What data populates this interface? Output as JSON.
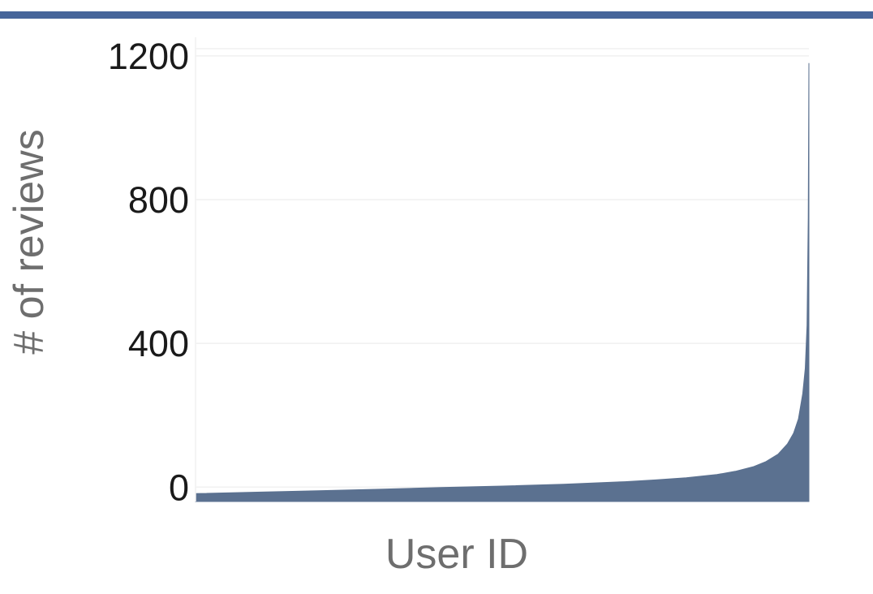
{
  "chart_data": {
    "type": "area",
    "title": "",
    "xlabel": "User ID",
    "ylabel": "# of reviews",
    "xlim": [
      0,
      1
    ],
    "ylim": [
      -40,
      1220
    ],
    "yticks": [
      0,
      400,
      800,
      1200
    ],
    "x_tick_labels_shown": false,
    "grid": true,
    "legend": "none",
    "fill_color": "#5b7190",
    "rule_color": "#46659a",
    "series": [
      {
        "x": [
          0,
          0.1,
          0.2,
          0.3,
          0.4,
          0.5,
          0.6,
          0.7,
          0.75,
          0.8,
          0.85,
          0.88,
          0.91,
          0.93,
          0.95,
          0.965,
          0.975,
          0.983,
          0.99,
          0.994,
          0.997,
          0.999,
          1.0
        ],
        "y": [
          -18,
          -14,
          -10,
          -6,
          -1,
          3,
          8,
          15,
          20,
          26,
          35,
          44,
          57,
          71,
          92,
          120,
          150,
          190,
          260,
          330,
          450,
          750,
          1180
        ]
      }
    ]
  }
}
